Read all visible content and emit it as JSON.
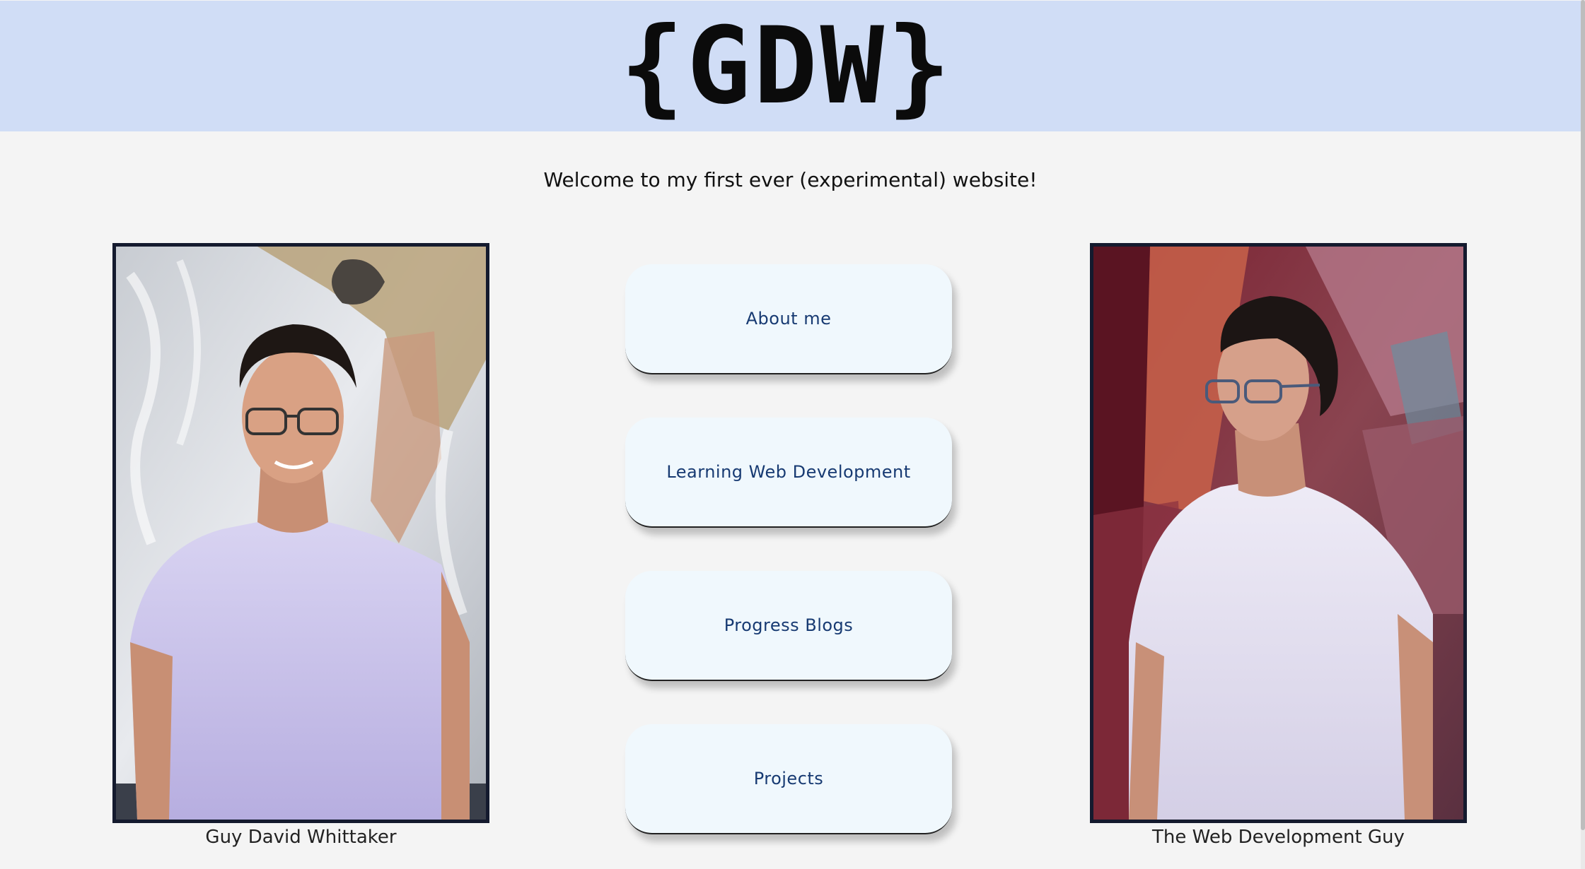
{
  "header": {
    "logo": "{GDW}"
  },
  "welcome_text": "Welcome to my first ever (experimental) website!",
  "nav": {
    "about": "About me",
    "learning": "Learning Web Development",
    "blogs": "Progress Blogs",
    "projects": "Projects"
  },
  "captions": {
    "left": "Guy David Whittaker",
    "right": "The Web Development Guy"
  },
  "colors": {
    "header_bg": "#d0ddf6",
    "page_bg": "#f4f4f4",
    "button_bg": "#f0f8fd",
    "button_text": "#173a72",
    "frame_border": "#141a2e"
  }
}
